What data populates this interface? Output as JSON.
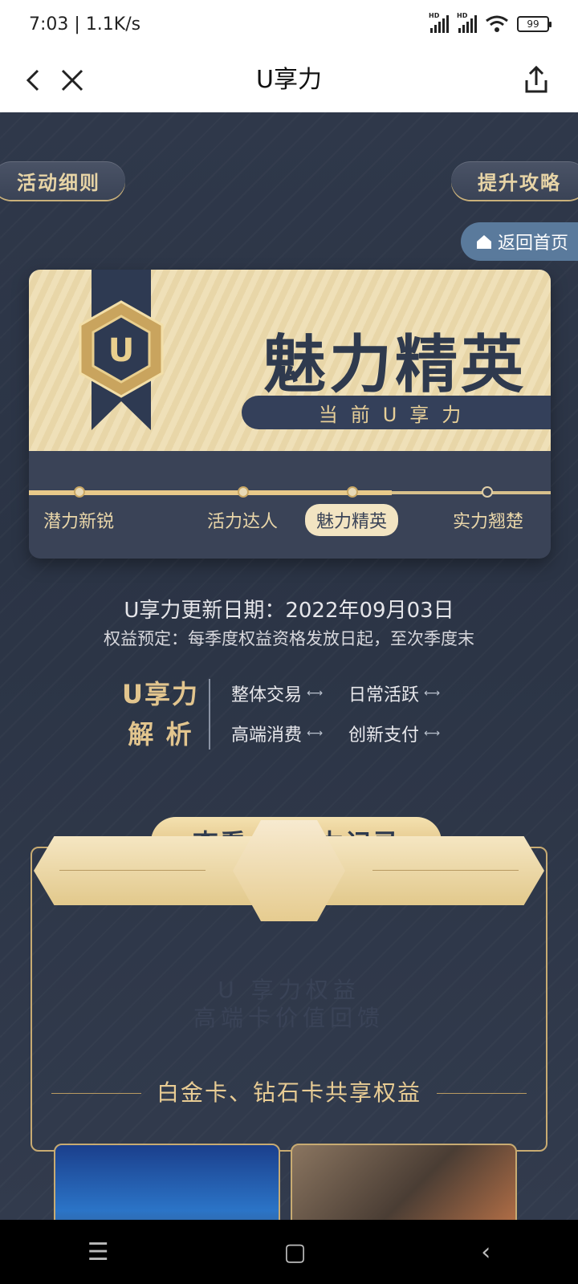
{
  "status_bar": {
    "time": "7:03",
    "speed": "1.1K/s",
    "battery": "99"
  },
  "nav": {
    "title": "U享力"
  },
  "top_actions": {
    "rules": "活动细则",
    "strategy": "提升攻略",
    "home": "返回首页"
  },
  "level_card": {
    "badge_letter": "U",
    "current_level": "魅力精英",
    "current_label": "当前U享力",
    "progress": 0.7,
    "levels": [
      {
        "label": "潜力新锐",
        "active": false
      },
      {
        "label": "活力达人",
        "active": false
      },
      {
        "label": "魅力精英",
        "active": true
      },
      {
        "label": "实力翘楚",
        "active": false
      }
    ]
  },
  "update_date": "U享力更新日期：2022年09月03日",
  "benefit_note": "权益预定：每季度权益资格发放日起，至次季度末",
  "analysis": {
    "title_line1": "U享力",
    "title_line2": "解  析",
    "items": [
      "整体交易",
      "日常活跃",
      "高端消费",
      "创新支付"
    ]
  },
  "record_button": "查看 U 享力记录",
  "benefits": {
    "banner_line1": "U 享力权益",
    "banner_line2": "高端卡价值回馈",
    "shared_title": "白金卡、钻石卡共享权益"
  },
  "colors": {
    "accent_gold": "#e2c58e",
    "background": "#2c3547",
    "home_pill": "#5a7a9c"
  }
}
